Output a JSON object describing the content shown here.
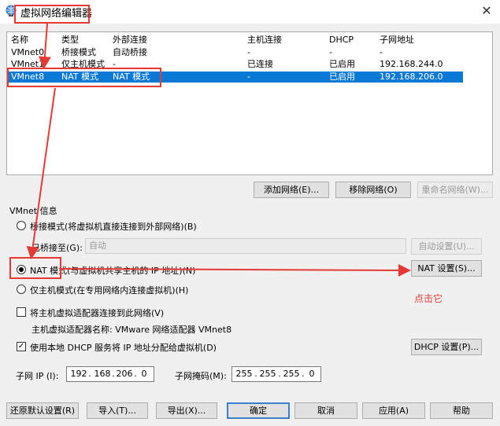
{
  "window": {
    "title": "虚拟网络编辑器",
    "close_label": "✕"
  },
  "icons": {
    "title": "globe-network-icon"
  },
  "colors": {
    "selection": "#0a79d6",
    "annotation": "#e53935"
  },
  "list": {
    "headers": [
      "名称",
      "类型",
      "外部连接",
      "主机连接",
      "DHCP",
      "子网地址"
    ],
    "rows": [
      [
        "VMnet0",
        "桥接模式",
        "自动桥接",
        "-",
        "-",
        "-"
      ],
      [
        "VMnet1",
        "仅主机模式",
        "-",
        "已连接",
        "已启用",
        "192.168.244.0"
      ],
      [
        "VMnet8",
        "NAT 模式",
        "NAT 模式",
        "-",
        "已启用",
        "192.168.206.0"
      ]
    ],
    "selected_index": 2
  },
  "list_buttons": {
    "add": "添加网络(E)...",
    "remove": "移除网络(O)",
    "rename": "重命名网络(W)..."
  },
  "vmnet_info": {
    "group_label": "VMnet 信息",
    "bridge_mode": "桥接模式(将虚拟机直接连接到外部网络)(B)",
    "bridge_to_label": "已桥接至(G):",
    "bridge_to_value": "自动",
    "auto_settings": "自动设置(U)...",
    "nat_mode": "NAT 模式(与虚拟机共享主机的 IP 地址)(N)",
    "nat_settings": "NAT 设置(S)...",
    "host_only": "仅主机模式(在专用网络内连接虚拟机)(H)",
    "selected_mode": "nat",
    "connect_adapter": "将主机虚拟适配器连接到此网络(V)",
    "connect_adapter_checked": false,
    "adapter_name": "主机虚拟适配器名称: VMware 网络适配器 VMnet8",
    "use_dhcp": "使用本地 DHCP 服务将 IP 地址分配给虚拟机(D)",
    "use_dhcp_checked": true,
    "dhcp_settings": "DHCP 设置(P)...",
    "subnet_ip_label": "子网 IP (I):",
    "subnet_ip": [
      "192",
      "168",
      "206",
      "0"
    ],
    "subnet_mask_label": "子网掩码(M):",
    "subnet_mask": [
      "255",
      "255",
      "255",
      "0"
    ]
  },
  "footer": {
    "restore": "还原默认设置(R)",
    "import": "导入(T)...",
    "export": "导出(X)...",
    "ok": "确定",
    "cancel": "取消",
    "apply": "应用(A)",
    "help": "帮助"
  },
  "annotation": {
    "click_it": "点击它"
  }
}
